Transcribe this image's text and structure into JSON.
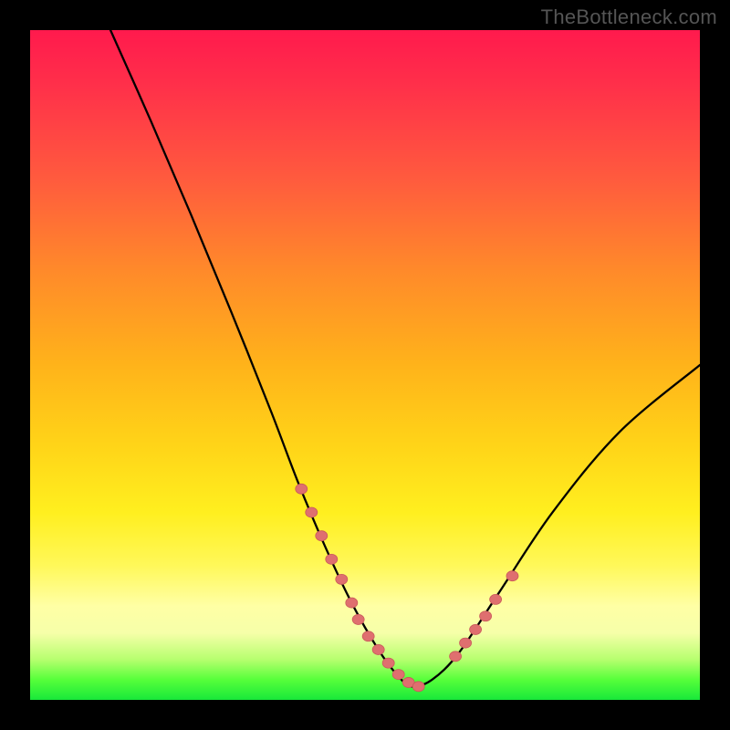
{
  "watermark": "TheBottleneck.com",
  "colors": {
    "frame": "#000000",
    "curve": "#000000",
    "marker_fill": "#df6f6f",
    "marker_stroke": "#c95a5a",
    "gradient_stops": [
      "#ff1a4d",
      "#ff2f4a",
      "#ff5a3e",
      "#ff8a2a",
      "#ffb31a",
      "#ffd418",
      "#ffef1f",
      "#fff85a",
      "#ffffa5",
      "#f6ffa9",
      "#b6ff6e",
      "#56ff3a",
      "#18e83a"
    ]
  },
  "chart_data": {
    "type": "line",
    "title": "",
    "xlabel": "",
    "ylabel": "",
    "xlim": [
      0,
      100
    ],
    "ylim": [
      0,
      100
    ],
    "grid": false,
    "legend": false,
    "note": "Axes are unlabeled in the source image; values are plot-fraction percentages (0 = left/bottom, 100 = right/top), estimated from pixels.",
    "series": [
      {
        "name": "curve",
        "kind": "smooth-line",
        "x": [
          12,
          18,
          24,
          30,
          36,
          40,
          44,
          48,
          52,
          55,
          57,
          60,
          64,
          70,
          78,
          88,
          100
        ],
        "y": [
          100,
          86.5,
          72.5,
          58,
          43,
          32.5,
          23,
          14.5,
          7.5,
          3.5,
          2,
          3,
          7,
          16,
          28,
          40,
          50
        ]
      },
      {
        "name": "markers-left",
        "kind": "markers",
        "x": [
          40.5,
          42.0,
          43.5,
          45.0,
          46.5,
          48.0,
          49.0,
          50.5,
          52.0,
          53.5,
          55.0,
          56.5,
          58.0
        ],
        "y": [
          31.5,
          28.0,
          24.5,
          21.0,
          18.0,
          14.5,
          12.0,
          9.5,
          7.5,
          5.5,
          3.8,
          2.6,
          2.0
        ]
      },
      {
        "name": "markers-right",
        "kind": "markers",
        "x": [
          63.5,
          65.0,
          66.5,
          68.0,
          69.5,
          72.0
        ],
        "y": [
          6.5,
          8.5,
          10.5,
          12.5,
          15.0,
          18.5
        ]
      }
    ]
  }
}
